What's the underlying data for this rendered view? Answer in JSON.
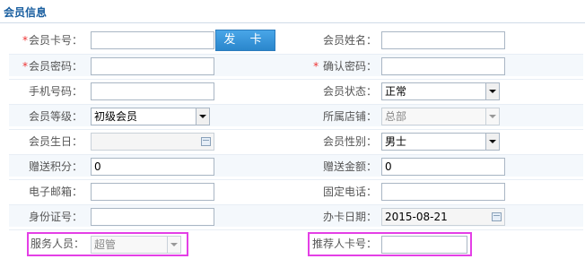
{
  "section_title": "会员信息",
  "required_mark": "*",
  "fields": {
    "card_no": {
      "label": "会员卡号：",
      "value": ""
    },
    "issue_button": "发 卡",
    "member_name": {
      "label": "会员姓名：",
      "value": ""
    },
    "password": {
      "label": "会员密码：",
      "value": ""
    },
    "confirm_password": {
      "label": "确认密码：",
      "value": ""
    },
    "phone": {
      "label": "手机号码：",
      "value": ""
    },
    "status": {
      "label": "会员状态：",
      "value": "正常"
    },
    "level": {
      "label": "会员等级：",
      "value": "初级会员"
    },
    "store": {
      "label": "所属店铺：",
      "value": "总部"
    },
    "birthday": {
      "label": "会员生日：",
      "value": ""
    },
    "gender": {
      "label": "会员性别：",
      "value": "男士"
    },
    "bonus_points": {
      "label": "赠送积分：",
      "value": "0"
    },
    "bonus_amount": {
      "label": "赠送金额：",
      "value": "0"
    },
    "email": {
      "label": "电子邮箱：",
      "value": ""
    },
    "landline": {
      "label": "固定电话：",
      "value": ""
    },
    "id_no": {
      "label": "身份证号：",
      "value": ""
    },
    "open_date": {
      "label": "办卡日期：",
      "value": "2015-08-21"
    },
    "service_staff": {
      "label": "服务人员：",
      "value": "超管"
    },
    "referrer_card": {
      "label": "推荐人卡号：",
      "value": ""
    }
  },
  "colors": {
    "title": "#1a5fa0",
    "required": "#e33333",
    "button": "#2a86cc",
    "highlight": "#e43fe6"
  }
}
